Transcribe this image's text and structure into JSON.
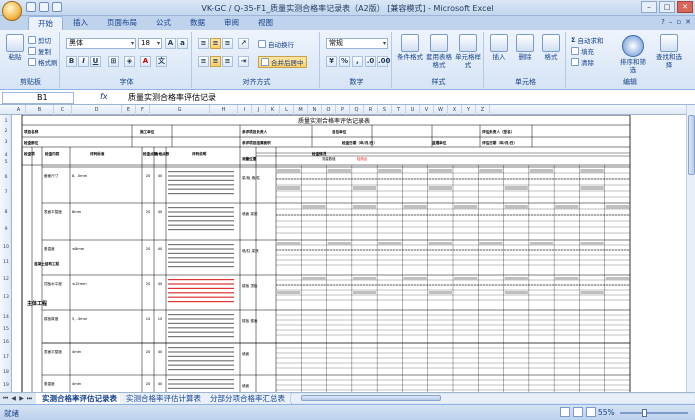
{
  "window": {
    "title": "VK-GC / Q-35-F1_质量实测合格率记录表（A2版） [兼容模式] - Microsoft Excel"
  },
  "tabs": [
    "开始",
    "插入",
    "页面布局",
    "公式",
    "数据",
    "审阅",
    "视图"
  ],
  "active_tab": "开始",
  "ribbon": {
    "clipboard": {
      "label": "剪贴板",
      "paste": "粘贴",
      "cut": "剪切",
      "copy": "复制",
      "painter": "格式刷"
    },
    "font": {
      "label": "字体",
      "name": "黑体",
      "size": "18"
    },
    "align": {
      "label": "对齐方式",
      "wrap": "自动换行",
      "merge": "合并后居中"
    },
    "number": {
      "label": "数字",
      "format": "常规"
    },
    "styles": {
      "label": "样式",
      "cond": "条件格式",
      "table": "套用表格格式",
      "cell": "单元格样式"
    },
    "cells": {
      "label": "单元格",
      "insert": "插入",
      "delete": "删除",
      "format": "格式"
    },
    "editing": {
      "label": "编辑",
      "autosum": "自动求和",
      "fill": "填充",
      "clear": "清除",
      "sort": "排序和筛选",
      "find": "查找和选择"
    }
  },
  "formula_bar": {
    "cell_ref": "B1",
    "fx": "fx",
    "content": "质量实测合格率评估记录"
  },
  "sheet": {
    "title": "质量实测合格率评估记录表",
    "header_row1": [
      "项目名称",
      "施工单位",
      "参评项目负责人",
      "总包单位",
      "评估负责人（签名）"
    ],
    "header_row2": [
      "检查部位",
      "参评项目结算面积",
      "检查日期（年/月/日）",
      "监理单位",
      "评估日期（年/月/日）"
    ],
    "col_titles": [
      "检查项",
      "检查内容",
      "评判标准",
      "检查点数",
      "合格点数",
      "评判说明",
      "检查情况",
      "测量位置"
    ],
    "measured_label": "测量数值",
    "red_label": "检测点",
    "section_main": "主体工程",
    "section_sub": "混凝土结构工程",
    "rows": [
      {
        "item": "截面尺寸",
        "std": "8, -5mm",
        "pts": "20",
        "ok": "40",
        "pos": "梁/板 墙/柱"
      },
      {
        "item": "表面平整度",
        "std": "8mm",
        "pts": "20",
        "ok": "40",
        "pos": "墙面 梁底"
      },
      {
        "item": "垂直度",
        "std": "≤8mm",
        "pts": "20",
        "ok": "40",
        "pos": "墙/柱 梁底"
      },
      {
        "item": "顶板水平度",
        "std": "≤15mm",
        "pts": "20",
        "ok": "40",
        "pos": "楼板 顶板"
      },
      {
        "item": "楼板厚度",
        "std": "5, -3mm",
        "pts": "10",
        "ok": "10",
        "pos": "楼板 楼面"
      },
      {
        "item": "表面平整度",
        "std": "4mm",
        "pts": "20",
        "ok": "40",
        "pos": "墙面"
      },
      {
        "item": "垂直度",
        "std": "4mm",
        "pts": "20",
        "ok": "40",
        "pos": "墙面"
      }
    ],
    "row_numbers": [
      "1",
      "2",
      "3",
      "4",
      "5",
      "6",
      "7",
      "8",
      "9",
      "10",
      "11",
      "12",
      "13",
      "14",
      "15",
      "16",
      "17",
      "18",
      "19"
    ],
    "col_letters": [
      "A",
      "B",
      "C",
      "D",
      "E",
      "F",
      "G",
      "H",
      "I",
      "J",
      "K",
      "L",
      "M",
      "N",
      "O",
      "P",
      "Q",
      "R",
      "S",
      "T",
      "U",
      "V",
      "W",
      "X",
      "Y",
      "Z"
    ]
  },
  "sheet_tabs": [
    "实测合格率评估记录表",
    "实测合格率评估计算表",
    "分部分项合格率汇总表"
  ],
  "active_sheet": "实测合格率评估记录表",
  "status": {
    "ready": "就绪",
    "zoom": "55%"
  }
}
